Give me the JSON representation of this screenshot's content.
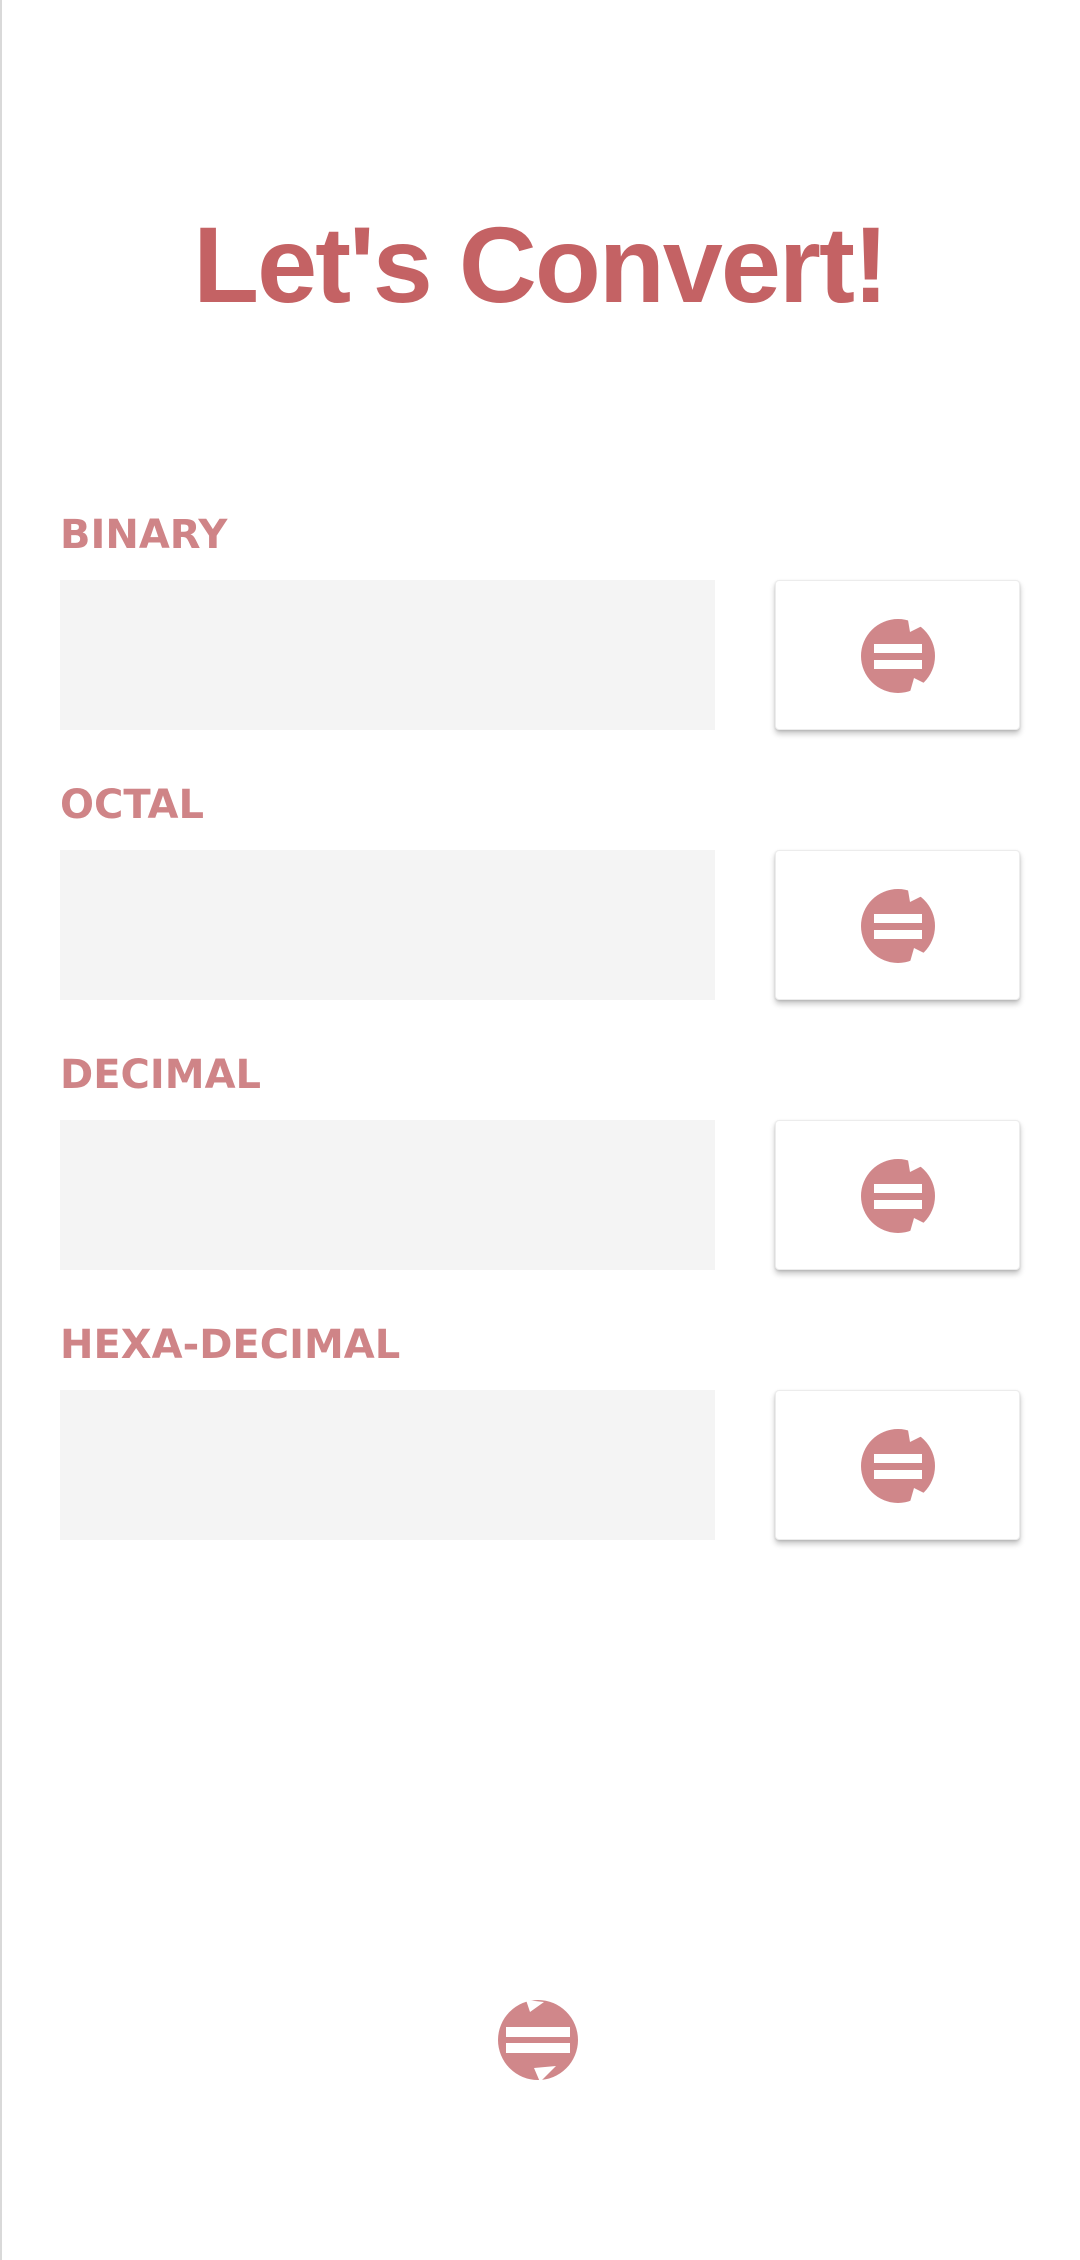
{
  "header": {
    "title": "Let's Convert!"
  },
  "fields": [
    {
      "label": "BINARY",
      "value": "",
      "icon": "convert-swap-icon"
    },
    {
      "label": "OCTAL",
      "value": "",
      "icon": "convert-swap-icon"
    },
    {
      "label": "DECIMAL",
      "value": "",
      "icon": "convert-swap-icon"
    },
    {
      "label": "HEXA-DECIMAL",
      "value": "",
      "icon": "convert-swap-icon"
    }
  ],
  "footer": {
    "icon": "convert-swap-icon"
  },
  "colors": {
    "title": "#c46264",
    "label": "#cf8487",
    "icon": "#d0878a",
    "input_background": "#f4f4f4"
  }
}
